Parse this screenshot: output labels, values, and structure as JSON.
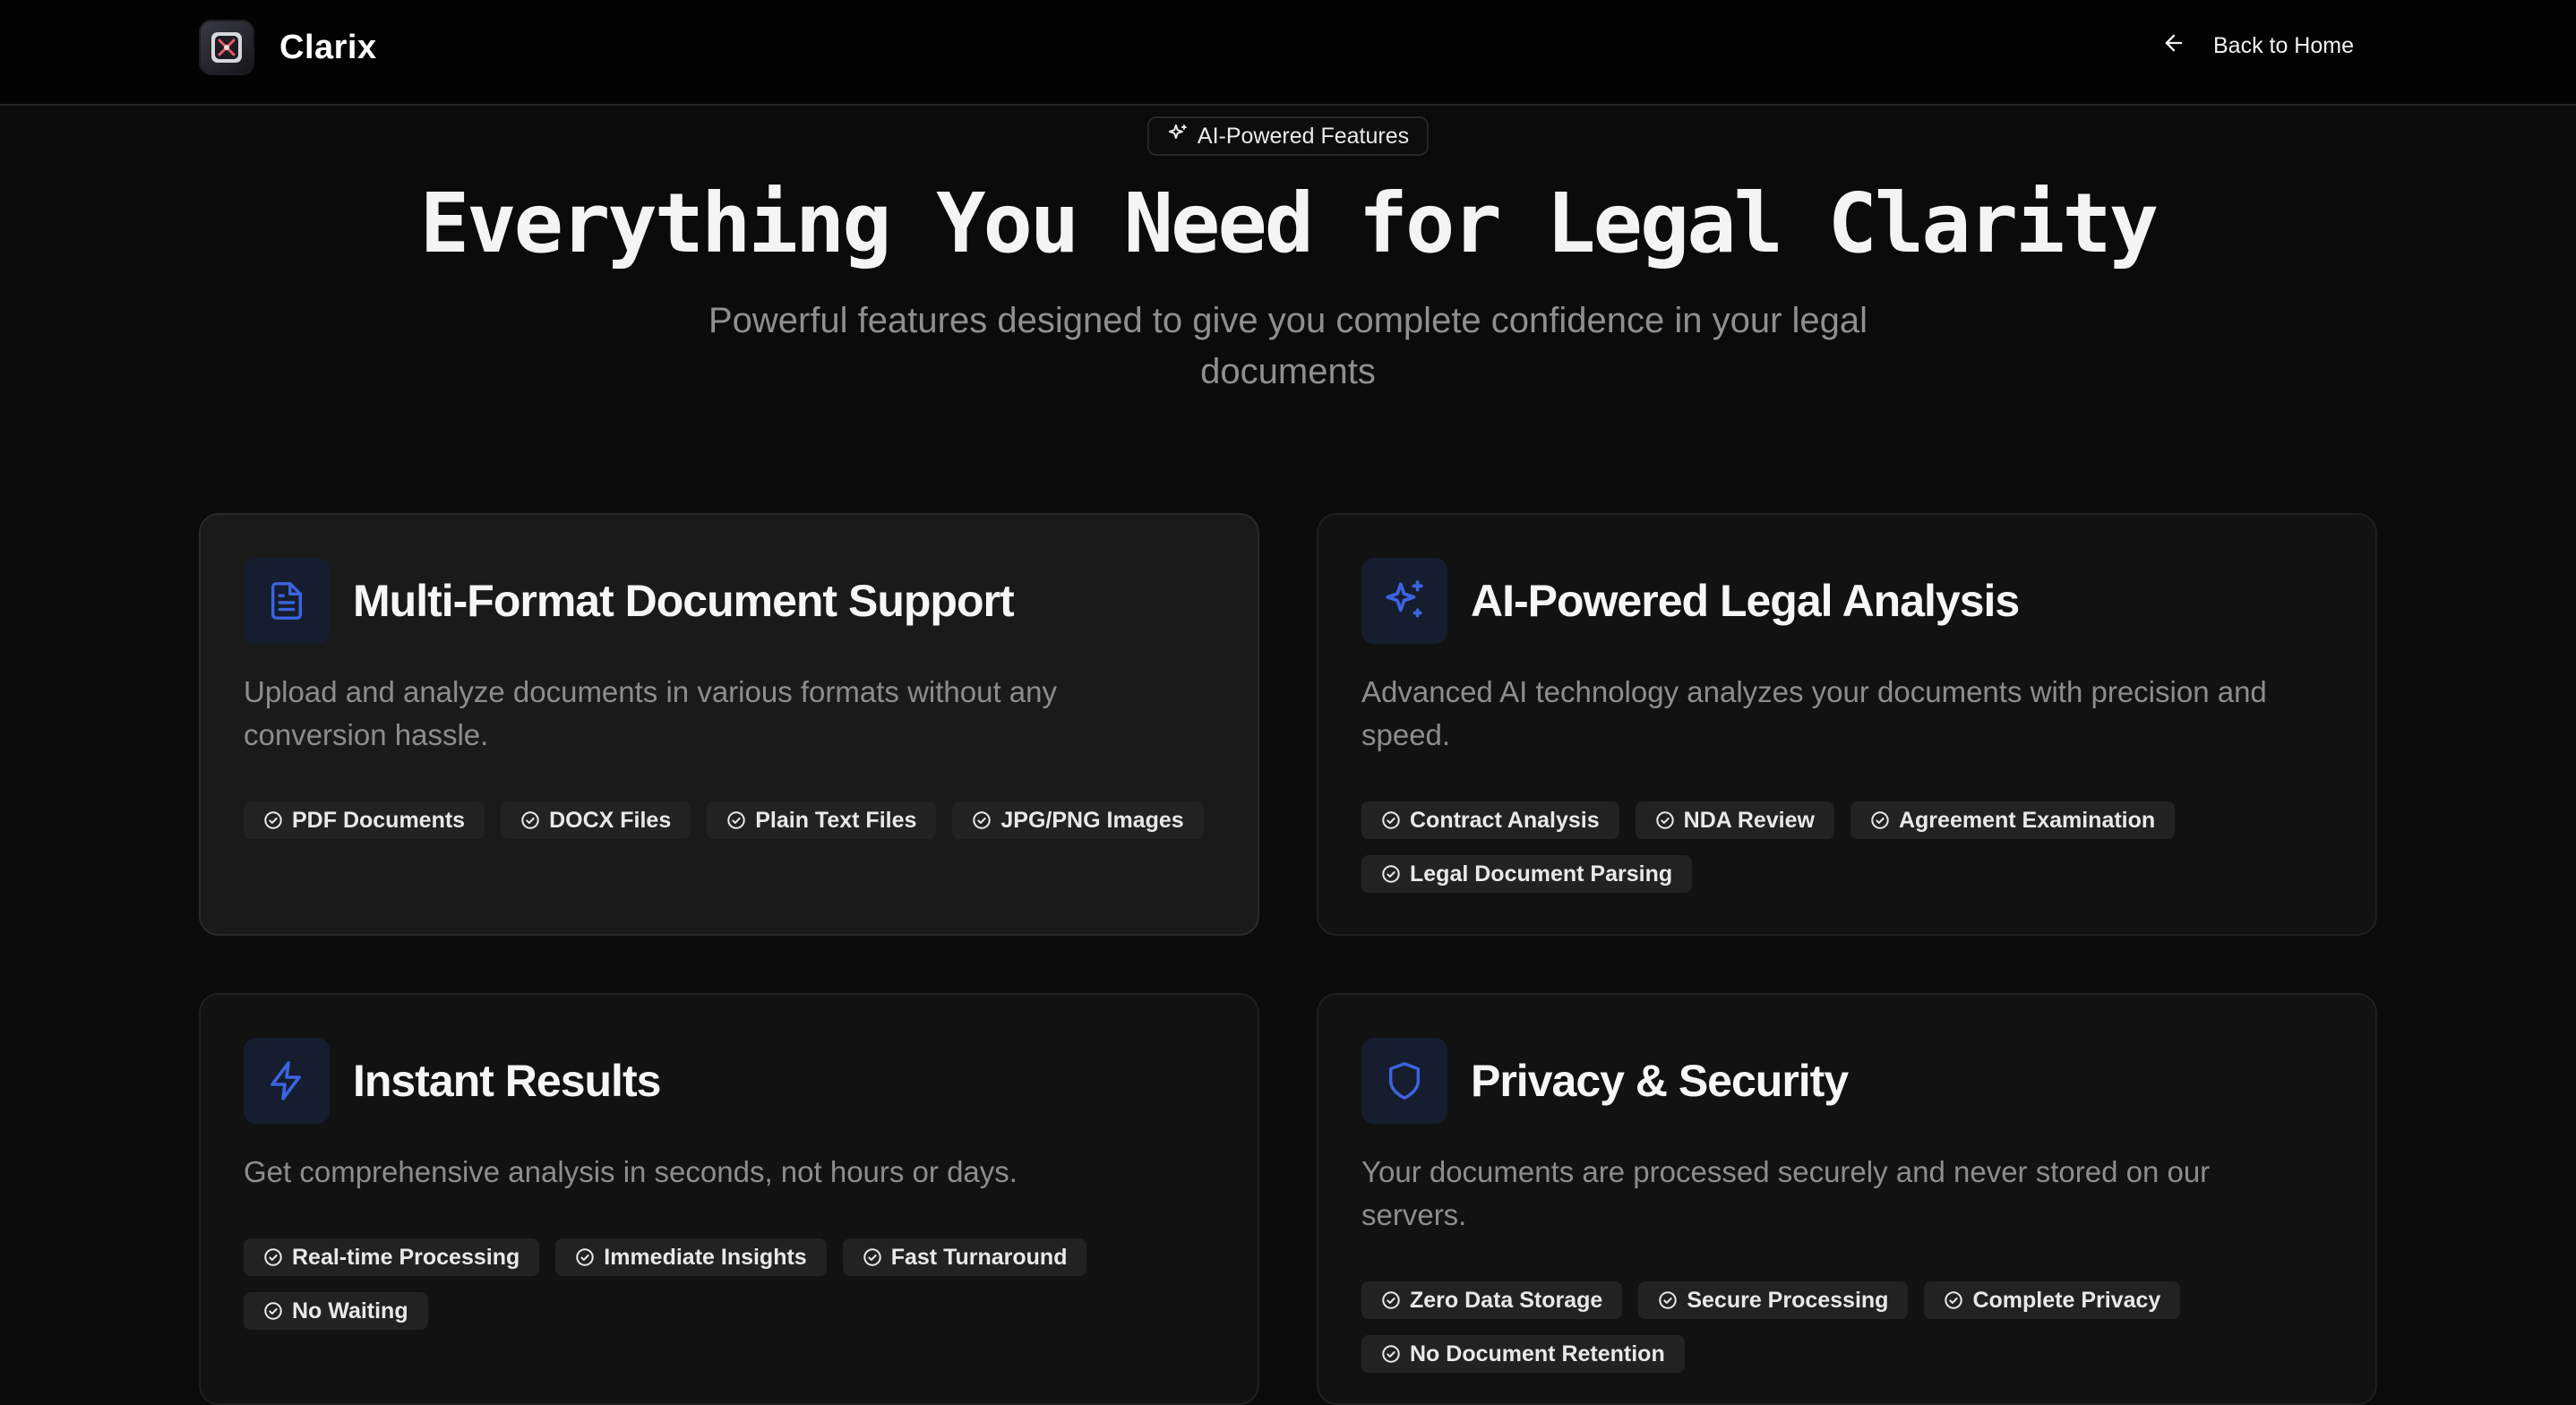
{
  "header": {
    "brand_name": "Clarix",
    "back_label": "Back to Home"
  },
  "hero": {
    "badge": "AI-Powered Features",
    "title": "Everything You Need for Legal Clarity",
    "subtitle": "Powerful features designed to give you complete confidence in your legal documents"
  },
  "colors": {
    "accent": "#3b64e0",
    "icon_bg": "#161d2e",
    "background": "#0b0b0b"
  },
  "features": [
    {
      "icon": "document-icon",
      "title": "Multi-Format Document Support",
      "description": "Upload and analyze documents in various formats without any conversion hassle.",
      "tags": [
        "PDF Documents",
        "DOCX Files",
        "Plain Text Files",
        "JPG/PNG Images"
      ]
    },
    {
      "icon": "sparkles-icon",
      "title": "AI-Powered Legal Analysis",
      "description": "Advanced AI technology analyzes your documents with precision and speed.",
      "tags": [
        "Contract Analysis",
        "NDA Review",
        "Agreement Examination",
        "Legal Document Parsing"
      ]
    },
    {
      "icon": "lightning-icon",
      "title": "Instant Results",
      "description": "Get comprehensive analysis in seconds, not hours or days.",
      "tags": [
        "Real-time Processing",
        "Immediate Insights",
        "Fast Turnaround",
        "No Waiting"
      ]
    },
    {
      "icon": "shield-icon",
      "title": "Privacy & Security",
      "description": "Your documents are processed securely and never stored on our servers.",
      "tags": [
        "Zero Data Storage",
        "Secure Processing",
        "Complete Privacy",
        "No Document Retention"
      ]
    }
  ]
}
